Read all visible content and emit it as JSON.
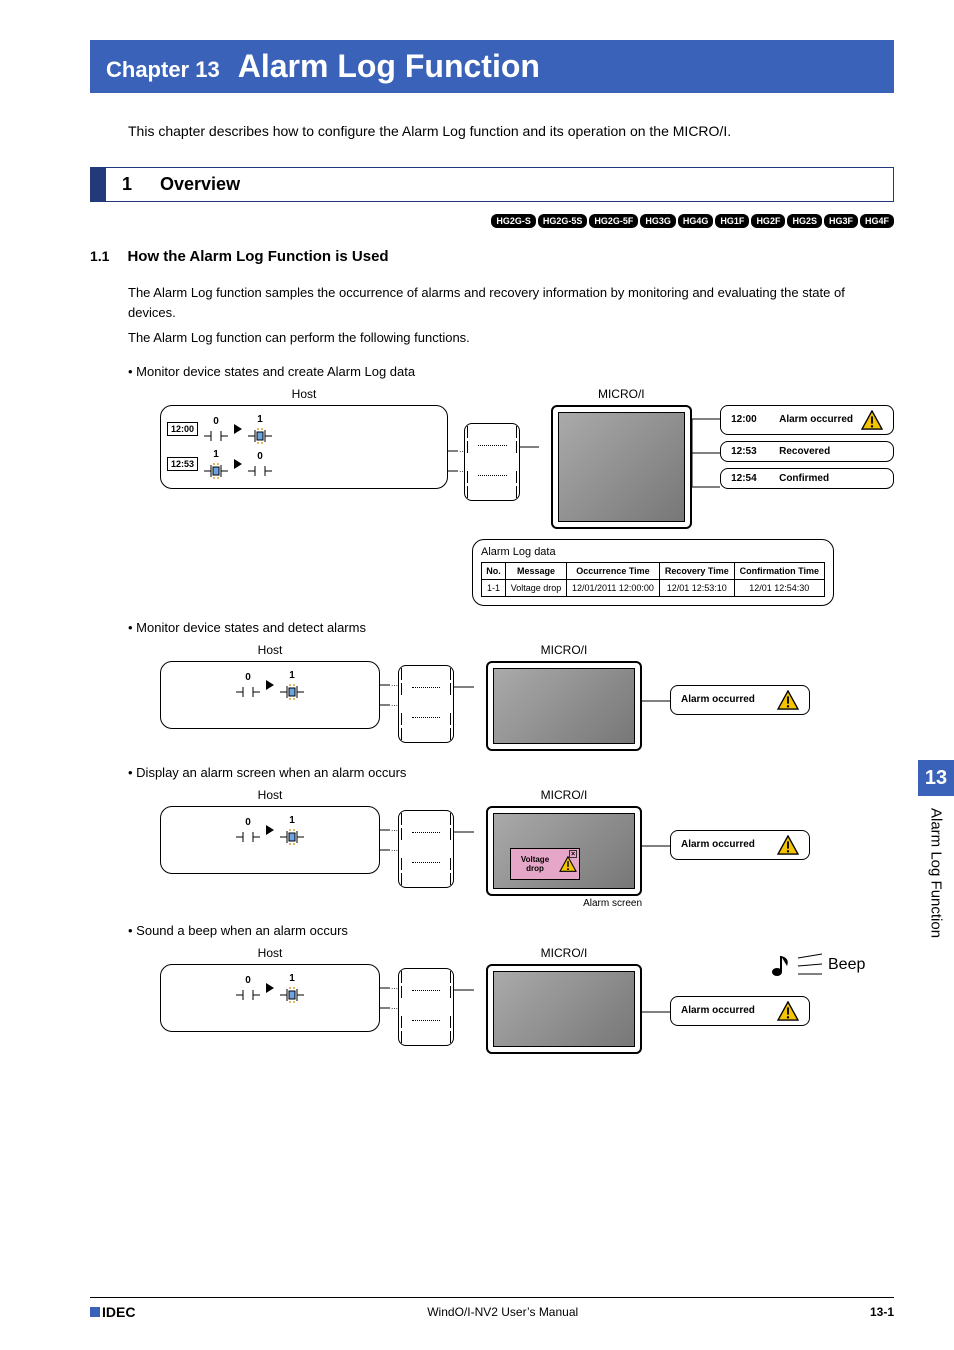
{
  "chapter": {
    "label": "Chapter 13",
    "title": "Alarm Log Function"
  },
  "intro": "This chapter describes how to configure the Alarm Log function and its operation on the MICRO/I.",
  "section": {
    "number": "1",
    "title": "Overview"
  },
  "badges": [
    "HG2G-S",
    "HG2G-5S",
    "HG2G-5F",
    "HG3G",
    "HG4G",
    "HG1F",
    "HG2F",
    "HG2S",
    "HG3F",
    "HG4F"
  ],
  "subsection": {
    "number": "1.1",
    "title": "How the Alarm Log Function is Used"
  },
  "para1": "The Alarm Log function samples the occurrence of alarms and recovery information by monitoring and evaluating the state of devices.",
  "para2": "The Alarm Log function can perform the following functions.",
  "bullet1": "Monitor device states and create Alarm Log data",
  "bullet2": "Monitor device states and detect alarms",
  "bullet3": "Display an alarm screen when an alarm occurs",
  "bullet4": "Sound a beep when an alarm occurs",
  "labels": {
    "host": "Host",
    "micro": "MICRO/I",
    "alarm_log_data": "Alarm Log data",
    "alarm_screen": "Alarm screen",
    "beep": "Beep"
  },
  "diagram1": {
    "row1": {
      "time": "12:00",
      "s1": "0",
      "s2": "1"
    },
    "row2": {
      "time": "12:53",
      "s1": "1",
      "s2": "0"
    },
    "callouts": [
      {
        "time": "12:00",
        "text": "Alarm occurred",
        "icon": true
      },
      {
        "time": "12:53",
        "text": "Recovered",
        "icon": false
      },
      {
        "time": "12:54",
        "text": "Confirmed",
        "icon": false
      }
    ],
    "table": {
      "headers": [
        "No.",
        "Message",
        "Occurrence Time",
        "Recovery Time",
        "Confirmation Time"
      ],
      "rows": [
        [
          "1-1",
          "Voltage drop",
          "12/01/2011 12:00:00",
          "12/01 12:53:10",
          "12/01 12:54:30"
        ]
      ]
    }
  },
  "diagram_simple": {
    "s1": "0",
    "s2": "1",
    "callout": {
      "text": "Alarm occurred"
    }
  },
  "diagram3": {
    "popup_text": "Voltage drop"
  },
  "sidetab": {
    "number": "13",
    "text": "Alarm Log Function"
  },
  "footer": {
    "logo_text": "IDEC",
    "center": "WindO/I-NV2 User’s Manual",
    "pageno": "13-1"
  }
}
